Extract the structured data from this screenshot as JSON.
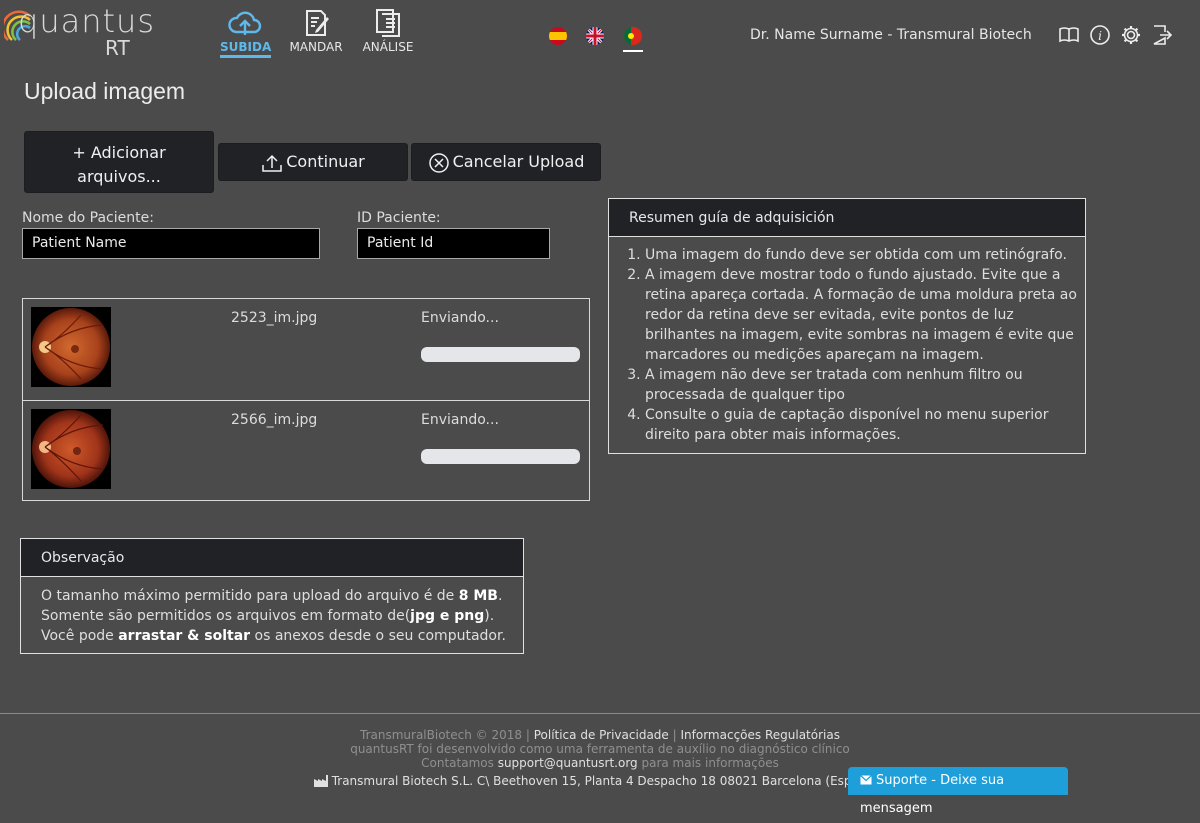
{
  "brand": {
    "logo_main": "quantus",
    "logo_sub": "RT"
  },
  "nav": {
    "items": [
      {
        "label": "SUBIDA",
        "icon": "cloud-upload-icon",
        "active": true
      },
      {
        "label": "MANDAR",
        "icon": "document-edit-icon",
        "active": false
      },
      {
        "label": "ANÁLISE",
        "icon": "document-stack-icon",
        "active": false
      }
    ]
  },
  "languages": [
    "es",
    "en",
    "pt"
  ],
  "selected_language": "pt",
  "user": {
    "name": "Dr. Name Surname - Transmural Biotech"
  },
  "header_icons": [
    "book-icon",
    "info-icon",
    "gear-icon",
    "logout-icon"
  ],
  "page": {
    "title": "Upload imagem"
  },
  "buttons": {
    "add_files": "Adicionar arquivos...",
    "add_files_line1": "Adicionar",
    "add_files_line2": "arquivos...",
    "continue": "Continuar",
    "cancel": "Cancelar Upload"
  },
  "form": {
    "patient_name_label": "Nome do Paciente:",
    "patient_name_value": "Patient Name",
    "patient_id_label": "ID Paciente:",
    "patient_id_value": "Patient Id"
  },
  "files": [
    {
      "name": "2523_im.jpg",
      "status": "Enviando...",
      "progress": 0
    },
    {
      "name": "2566_im.jpg",
      "status": "Enviando...",
      "progress": 0
    }
  ],
  "guide": {
    "title": "Resumen guía de adquisición",
    "items": [
      "Uma imagem do fundo deve ser obtida com um retinógrafo.",
      "A imagem deve mostrar todo o fundo ajustado. Evite que a retina apareça cortada. A formação de uma moldura preta ao redor da retina deve ser evitada, evite pontos de luz brilhantes na imagem, evite sombras na imagem é evite que marcadores ou medições apareçam na imagem.",
      "A imagem não deve ser tratada com nenhum filtro ou processada de qualquer tipo",
      "Consulte o guia de captação disponível no menu superior direito para obter mais informações."
    ]
  },
  "observation": {
    "title": "Observação",
    "line1_pre": "O tamanho máximo permitido para upload do arquivo é de ",
    "line1_bold": "8 MB",
    "line1_post": ".",
    "line2_pre": "Somente são permitidos os arquivos em formato de(",
    "line2_bold": "jpg e png",
    "line2_post": ").",
    "line3_pre": "Você pode ",
    "line3_bold": "arrastar & soltar",
    "line3_post": " os anexos desde o seu computador."
  },
  "footer": {
    "copyright": "TransmuralBiotech © 2018 |",
    "privacy": "Política de Privacidade",
    "sep": "|",
    "regulatory": "Informacções Regulatórias",
    "line2": "quantusRT foi desenvolvido como uma ferramenta de auxílio no diagnóstico clínico",
    "line3_pre": "Contatamos",
    "email": "support@quantusrt.org",
    "line3_post": "para mais informações",
    "address": "Transmural Biotech S.L. C\\ Beethoven 15, Planta 4 Despacho 18 08021 Barcelona (Espanha)"
  },
  "support": {
    "label": "Suporte - Deixe sua mensagem"
  },
  "colors": {
    "background": "#4c4b4c",
    "accent": "#5fb8ea",
    "dark": "#202226",
    "support": "#1e9fd9"
  }
}
